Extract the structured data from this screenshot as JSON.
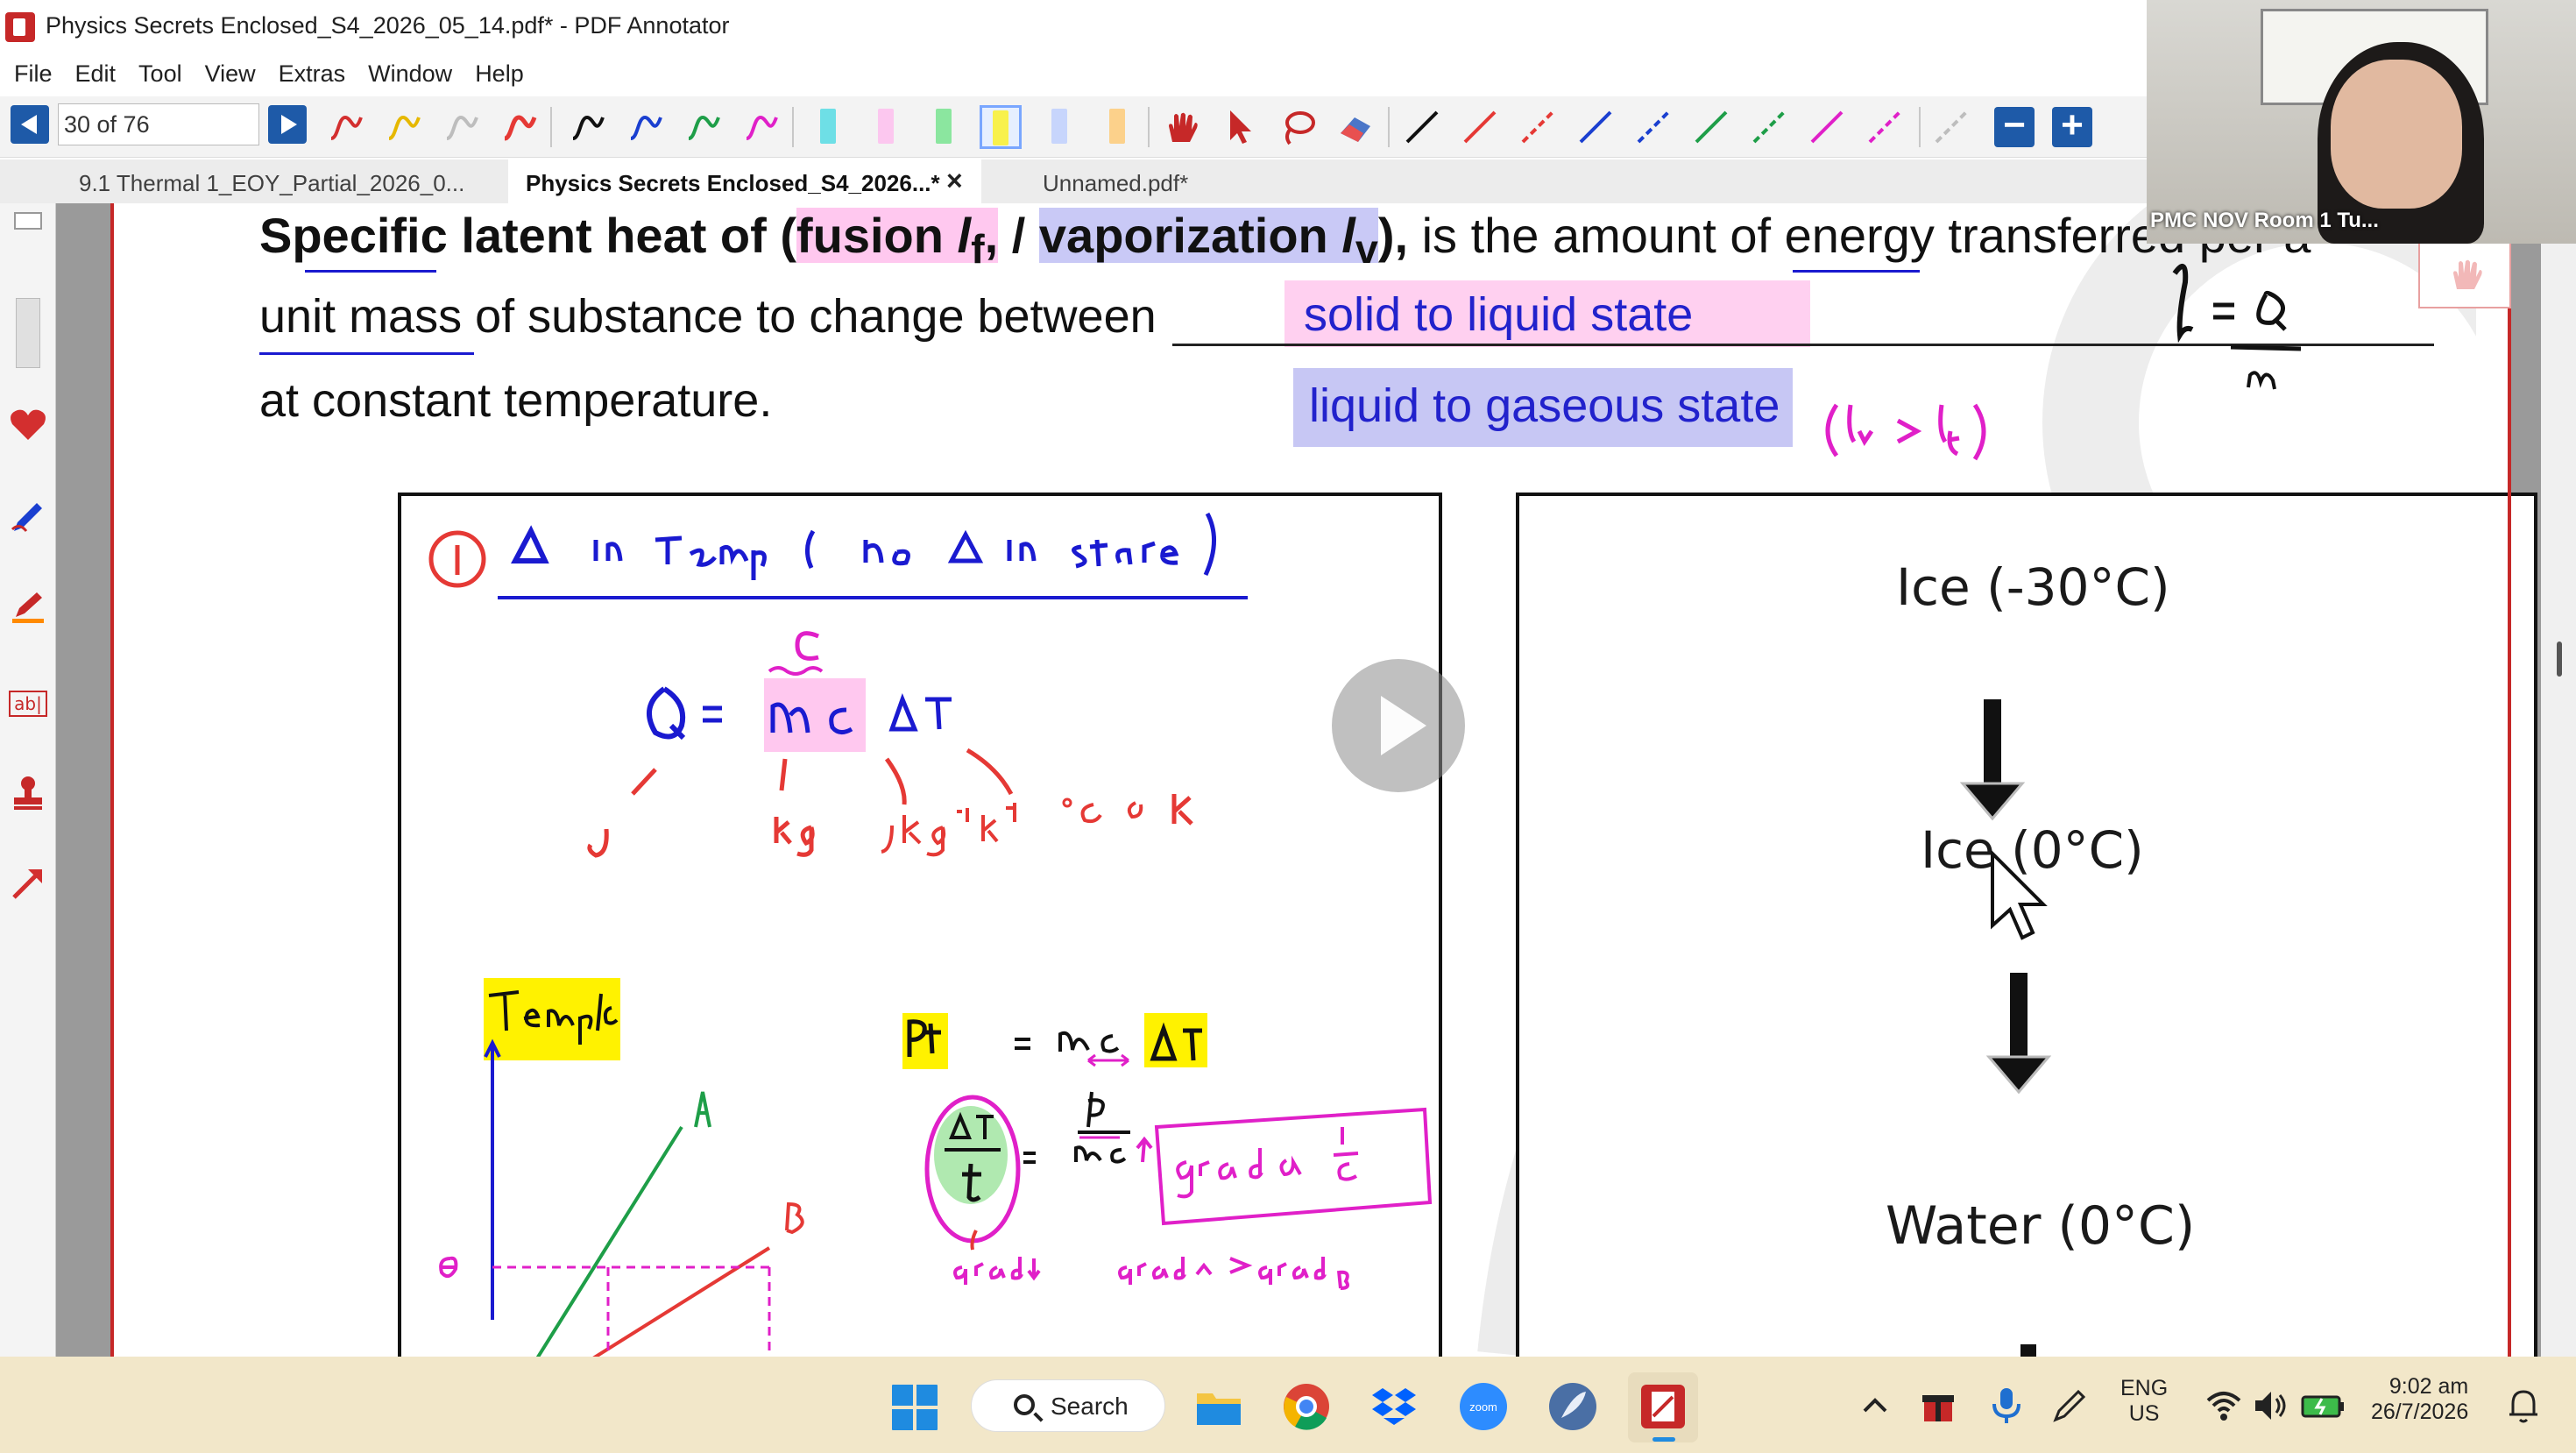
{
  "window": {
    "title": "Physics Secrets Enclosed_S4_2026_05_14.pdf* - PDF Annotator"
  },
  "menu": [
    "File",
    "Edit",
    "Tool",
    "View",
    "Extras",
    "Window",
    "Help"
  ],
  "toolbar": {
    "page_indicator": "30 of 76"
  },
  "tabs": [
    {
      "label": "9.1 Thermal 1_EOY_Partial_2026_0...",
      "active": false
    },
    {
      "label": "Physics Secrets Enclosed_S4_2026...*",
      "active": true
    },
    {
      "label": "Unnamed.pdf*",
      "active": false
    }
  ],
  "document": {
    "definition": {
      "bold_part": "Specific latent heat of (",
      "fusion": "fusion",
      "lf_symbol": "l",
      "lf_sub": "f",
      "comma": ",",
      "slash": " /",
      "vaporization": "vaporization",
      "lv_symbol": "l",
      "lv_sub": "v",
      "close_paren": "),",
      "line1_rest": " is the amount of energy transferred per a",
      "line2": "unit mass of substance to change between",
      "line3": "at constant temperature.",
      "blank1": "solid to liquid state",
      "blank2": "liquid to gaseous state"
    },
    "flow": {
      "ice_cold": "Ice (-30°C)",
      "ice_zero": "Ice (0°C)",
      "water_zero": "Water (0°C)"
    }
  },
  "video": {
    "participant_name": "PMC NOV Room 1 Tu..."
  },
  "taskbar": {
    "search_label": "Search",
    "language_top": "ENG",
    "language_bottom": "US",
    "time": "9:02 am",
    "date": "26/7/2026"
  }
}
